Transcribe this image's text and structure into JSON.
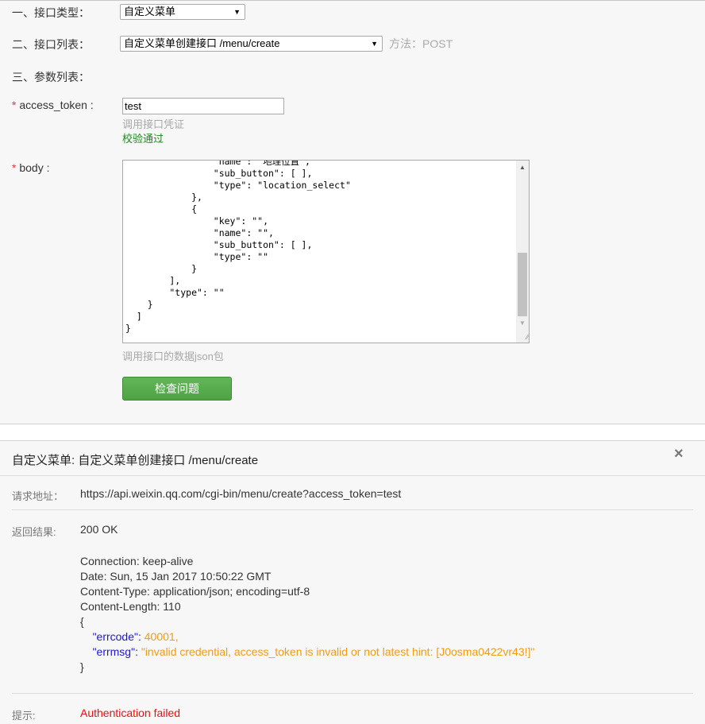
{
  "form": {
    "interface_type": {
      "label": "一、接口类型：",
      "selected": "自定义菜单"
    },
    "interface_list": {
      "label": "二、接口列表：",
      "selected": "自定义菜单创建接口 /menu/create",
      "method": "方法：POST"
    },
    "params": {
      "label": "三、参数列表："
    },
    "access_token": {
      "required_mark": "*",
      "label": " access_token :",
      "value": "test",
      "hint": "调用接口凭证",
      "validation": "校验通过"
    },
    "body": {
      "required_mark": "*",
      "label": " body :",
      "content": "                \"name\": \"地理位置\",\n                \"sub_button\": [ ],\n                \"type\": \"location_select\"\n            },\n            {\n                \"key\": \"\",\n                \"name\": \"\",\n                \"sub_button\": [ ],\n                \"type\": \"\"\n            }\n        ],\n        \"type\": \"\"\n    }\n  ]\n}",
      "hint": "调用接口的数据json包"
    },
    "check_button": "检查问题"
  },
  "result": {
    "title": "自定义菜单: 自定义菜单创建接口 /menu/create",
    "close_icon": "×",
    "request_url": {
      "label": "请求地址：",
      "value": "https://api.weixin.qq.com/cgi-bin/menu/create?access_token=test"
    },
    "response": {
      "label": "返回结果:",
      "status": "200 OK",
      "headers": [
        "Connection: keep-alive",
        "Date: Sun, 15 Jan 2017 10:50:22 GMT",
        "Content-Type: application/json; encoding=utf-8",
        "Content-Length: 110"
      ],
      "open_brace": "{",
      "errcode_key": "\"errcode\"",
      "errcode_value": "40001,",
      "errmsg_key": "\"errmsg\"",
      "errmsg_value": "\"invalid credential, access_token is invalid or not latest hint: [J0osma0422vr43!]\"",
      "close_brace": "}"
    },
    "tip": {
      "label": "提示:",
      "value": "Authentication failed"
    }
  }
}
